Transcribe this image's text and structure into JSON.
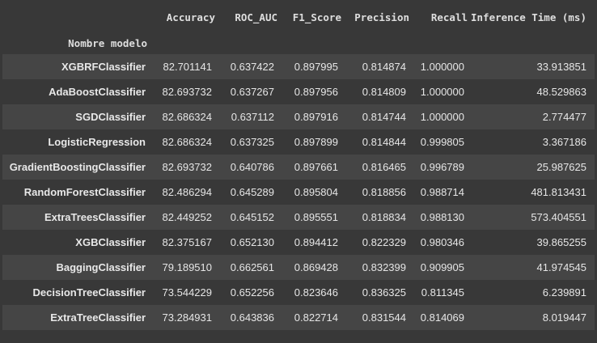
{
  "table": {
    "index_name": "Nombre modelo",
    "columns": [
      "Accuracy",
      "ROC_AUC",
      "F1_Score",
      "Precision",
      "Recall",
      "Inference Time (ms)"
    ],
    "rows": [
      {
        "model": "XGBRFClassifier",
        "values": [
          "82.701141",
          "0.637422",
          "0.897995",
          "0.814874",
          "1.000000",
          "33.913851"
        ]
      },
      {
        "model": "AdaBoostClassifier",
        "values": [
          "82.693732",
          "0.637267",
          "0.897956",
          "0.814809",
          "1.000000",
          "48.529863"
        ]
      },
      {
        "model": "SGDClassifier",
        "values": [
          "82.686324",
          "0.637112",
          "0.897916",
          "0.814744",
          "1.000000",
          "2.774477"
        ]
      },
      {
        "model": "LogisticRegression",
        "values": [
          "82.686324",
          "0.637325",
          "0.897899",
          "0.814844",
          "0.999805",
          "3.367186"
        ]
      },
      {
        "model": "GradientBoostingClassifier",
        "values": [
          "82.693732",
          "0.640786",
          "0.897661",
          "0.816465",
          "0.996789",
          "25.987625"
        ]
      },
      {
        "model": "RandomForestClassifier",
        "values": [
          "82.486294",
          "0.645289",
          "0.895804",
          "0.818856",
          "0.988714",
          "481.813431"
        ]
      },
      {
        "model": "ExtraTreesClassifier",
        "values": [
          "82.449252",
          "0.645152",
          "0.895551",
          "0.818834",
          "0.988130",
          "573.404551"
        ]
      },
      {
        "model": "XGBClassifier",
        "values": [
          "82.375167",
          "0.652130",
          "0.894412",
          "0.822329",
          "0.980346",
          "39.865255"
        ]
      },
      {
        "model": "BaggingClassifier",
        "values": [
          "79.189510",
          "0.662561",
          "0.869428",
          "0.832399",
          "0.909905",
          "41.974545"
        ]
      },
      {
        "model": "DecisionTreeClassifier",
        "values": [
          "73.544229",
          "0.652256",
          "0.823646",
          "0.836325",
          "0.811345",
          "6.239891"
        ]
      },
      {
        "model": "ExtraTreeClassifier",
        "values": [
          "73.284931",
          "0.643836",
          "0.822714",
          "0.831544",
          "0.814069",
          "8.019447"
        ]
      }
    ]
  }
}
